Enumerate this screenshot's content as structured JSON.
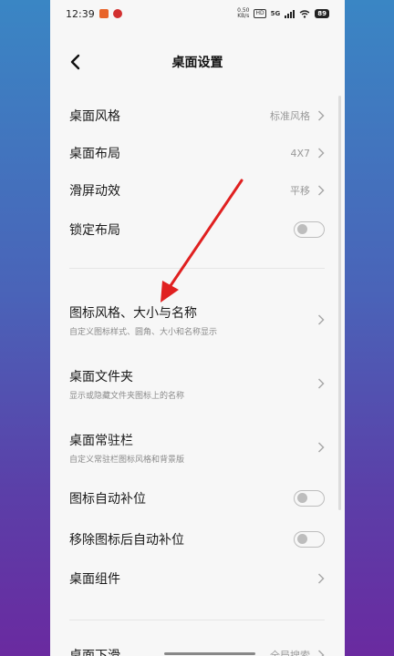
{
  "status_bar": {
    "time": "12:39",
    "net_speed_value": "0.50",
    "net_speed_unit": "KB/s",
    "hd_label": "HD",
    "network": "5G",
    "battery": "89"
  },
  "header": {
    "title": "桌面设置"
  },
  "settings": [
    {
      "label": "桌面风格",
      "value": "标准风格"
    },
    {
      "label": "桌面布局",
      "value": "4X7"
    },
    {
      "label": "滑屏动效",
      "value": "平移"
    },
    {
      "label": "锁定布局",
      "toggle": false
    },
    {
      "label": "图标风格、大小与名称",
      "subtitle": "自定义图标样式、圆角、大小和名称显示"
    },
    {
      "label": "桌面文件夹",
      "subtitle": "显示或隐藏文件夹图标上的名称"
    },
    {
      "label": "桌面常驻栏",
      "subtitle": "自定义常驻栏图标风格和背景版"
    },
    {
      "label": "图标自动补位",
      "toggle": false
    },
    {
      "label": "移除图标后自动补位",
      "toggle": false
    },
    {
      "label": "桌面组件"
    },
    {
      "label": "桌面下滑",
      "value": "全局搜索"
    }
  ],
  "colors": {
    "annotation_arrow": "#e02020",
    "toggle_off": "#bdbdbd",
    "status_icon_1": "#e8642a",
    "status_icon_2": "#d23030"
  }
}
